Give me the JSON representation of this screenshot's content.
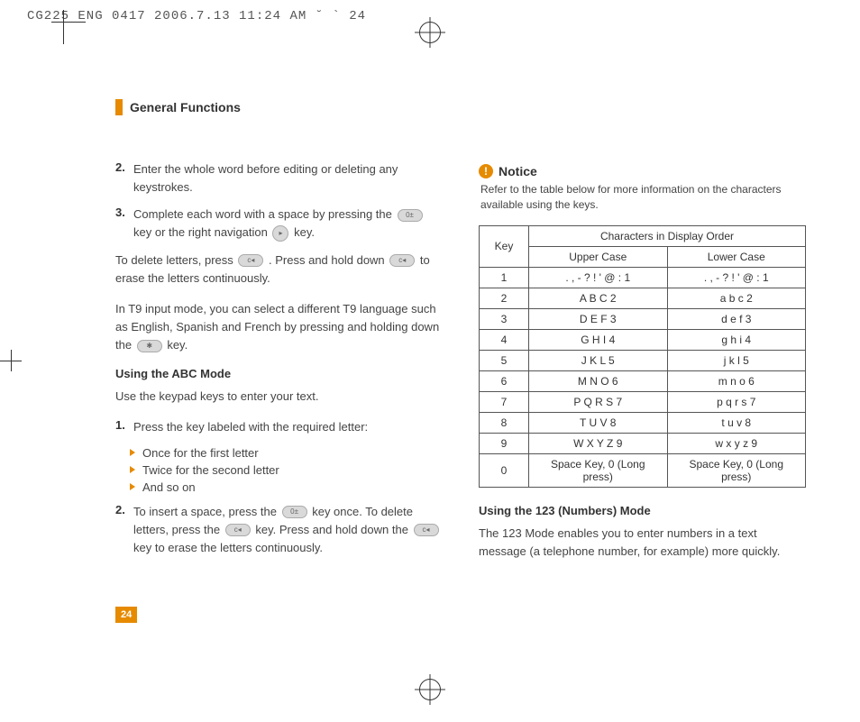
{
  "header": {
    "text": "CG225 ENG 0417  2006.7.13 11:24 AM  ˘   ` 24"
  },
  "section": {
    "title": "General Functions"
  },
  "left": {
    "item2_num": "2.",
    "item2_text": "Enter the whole word before editing or deleting any keystrokes.",
    "item3_num": "3.",
    "item3_text_a": "Complete each word with a space by pressing the ",
    "item3_text_b": " key or the right navigation ",
    "item3_text_c": " key.",
    "delete_a": "To delete letters, press ",
    "delete_b": " . Press and hold down ",
    "delete_c": " to erase the letters continuously.",
    "t9_text_a": "In T9 input mode, you can select a different T9 language such as English, Spanish and French by pressing and holding down the ",
    "t9_text_b": " key.",
    "abc_heading": "Using the ABC Mode",
    "abc_intro": "Use the keypad keys to enter your text.",
    "abc1_num": "1.",
    "abc1_text": "Press the key labeled with the required letter:",
    "bullet1": "Once for the first letter",
    "bullet2": "Twice for the second letter",
    "bullet3": "And so on",
    "abc2_num": "2.",
    "abc2_text_a": "To insert a space, press the ",
    "abc2_text_b": " key once. To delete letters, press the ",
    "abc2_text_c": " key. Press and hold down the ",
    "abc2_text_d": " key to erase the letters continuously."
  },
  "right": {
    "notice_label": "Notice",
    "notice_text": "Refer to the table below for more information on the characters available using the keys.",
    "table": {
      "key_label": "Key",
      "header_span": "Characters in Display Order",
      "upper_label": "Upper Case",
      "lower_label": "Lower Case",
      "rows": [
        {
          "k": "1",
          "u": ". , - ? ! ' @ : 1",
          "l": ". , - ? ! ' @ : 1"
        },
        {
          "k": "2",
          "u": "A B C 2",
          "l": "a b c 2"
        },
        {
          "k": "3",
          "u": "D E F 3",
          "l": "d e f 3"
        },
        {
          "k": "4",
          "u": "G H I 4",
          "l": "g h i 4"
        },
        {
          "k": "5",
          "u": "J K L 5",
          "l": "j k l 5"
        },
        {
          "k": "6",
          "u": "M N O 6",
          "l": "m n o 6"
        },
        {
          "k": "7",
          "u": "P Q R S 7",
          "l": "p q r s 7"
        },
        {
          "k": "8",
          "u": "T U V 8",
          "l": "t u v 8"
        },
        {
          "k": "9",
          "u": "W X Y Z 9",
          "l": "w x y z 9"
        },
        {
          "k": "0",
          "u": "Space Key, 0 (Long press)",
          "l": "Space Key, 0 (Long press)"
        }
      ]
    },
    "mode123_heading": "Using the 123 (Numbers) Mode",
    "mode123_text": "The 123 Mode enables you to enter numbers in a text message (a telephone number, for example) more quickly."
  },
  "page_number": "24",
  "chart_data": {
    "type": "table",
    "title": "Characters in Display Order",
    "columns": [
      "Key",
      "Upper Case",
      "Lower Case"
    ],
    "rows": [
      [
        "1",
        ". , - ? ! ' @ : 1",
        ". , - ? ! ' @ : 1"
      ],
      [
        "2",
        "A B C 2",
        "a b c 2"
      ],
      [
        "3",
        "D E F 3",
        "d e f 3"
      ],
      [
        "4",
        "G H I 4",
        "g h i 4"
      ],
      [
        "5",
        "J K L 5",
        "j k l 5"
      ],
      [
        "6",
        "M N O 6",
        "m n o 6"
      ],
      [
        "7",
        "P Q R S 7",
        "p q r s 7"
      ],
      [
        "8",
        "T U V 8",
        "t u v 8"
      ],
      [
        "9",
        "W X Y Z 9",
        "w x y z 9"
      ],
      [
        "0",
        "Space Key, 0 (Long press)",
        "Space Key, 0 (Long press)"
      ]
    ]
  }
}
